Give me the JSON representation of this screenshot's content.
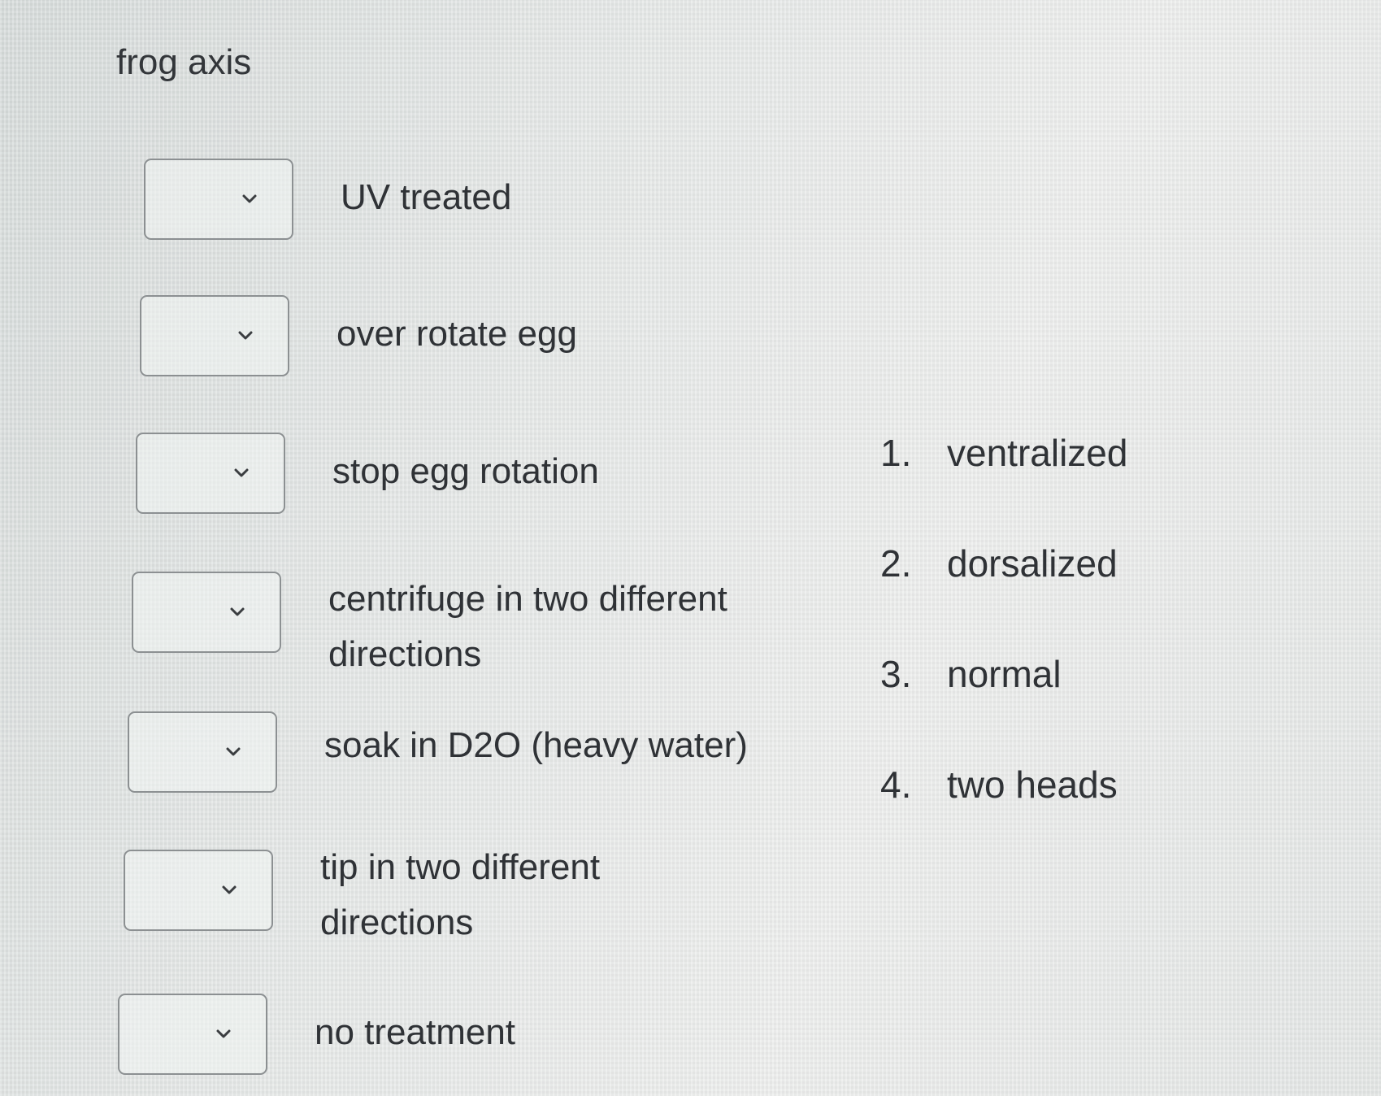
{
  "question": {
    "title": "frog axis"
  },
  "rows": [
    {
      "label": "UV treated",
      "selected": ""
    },
    {
      "label": "over rotate egg",
      "selected": ""
    },
    {
      "label": "stop egg rotation",
      "selected": ""
    },
    {
      "label": "centrifuge in two different directions",
      "selected": ""
    },
    {
      "label": "soak in D2O (heavy water)",
      "selected": ""
    },
    {
      "label": "tip in two different directions",
      "selected": ""
    },
    {
      "label": "no treatment",
      "selected": ""
    }
  ],
  "options": [
    {
      "number": "1.",
      "text": "ventralized"
    },
    {
      "number": "2.",
      "text": "dorsalized"
    },
    {
      "number": "3.",
      "text": "normal"
    },
    {
      "number": "4.",
      "text": "two heads"
    }
  ],
  "icons": {
    "dropdown": "chevron-down-icon"
  }
}
